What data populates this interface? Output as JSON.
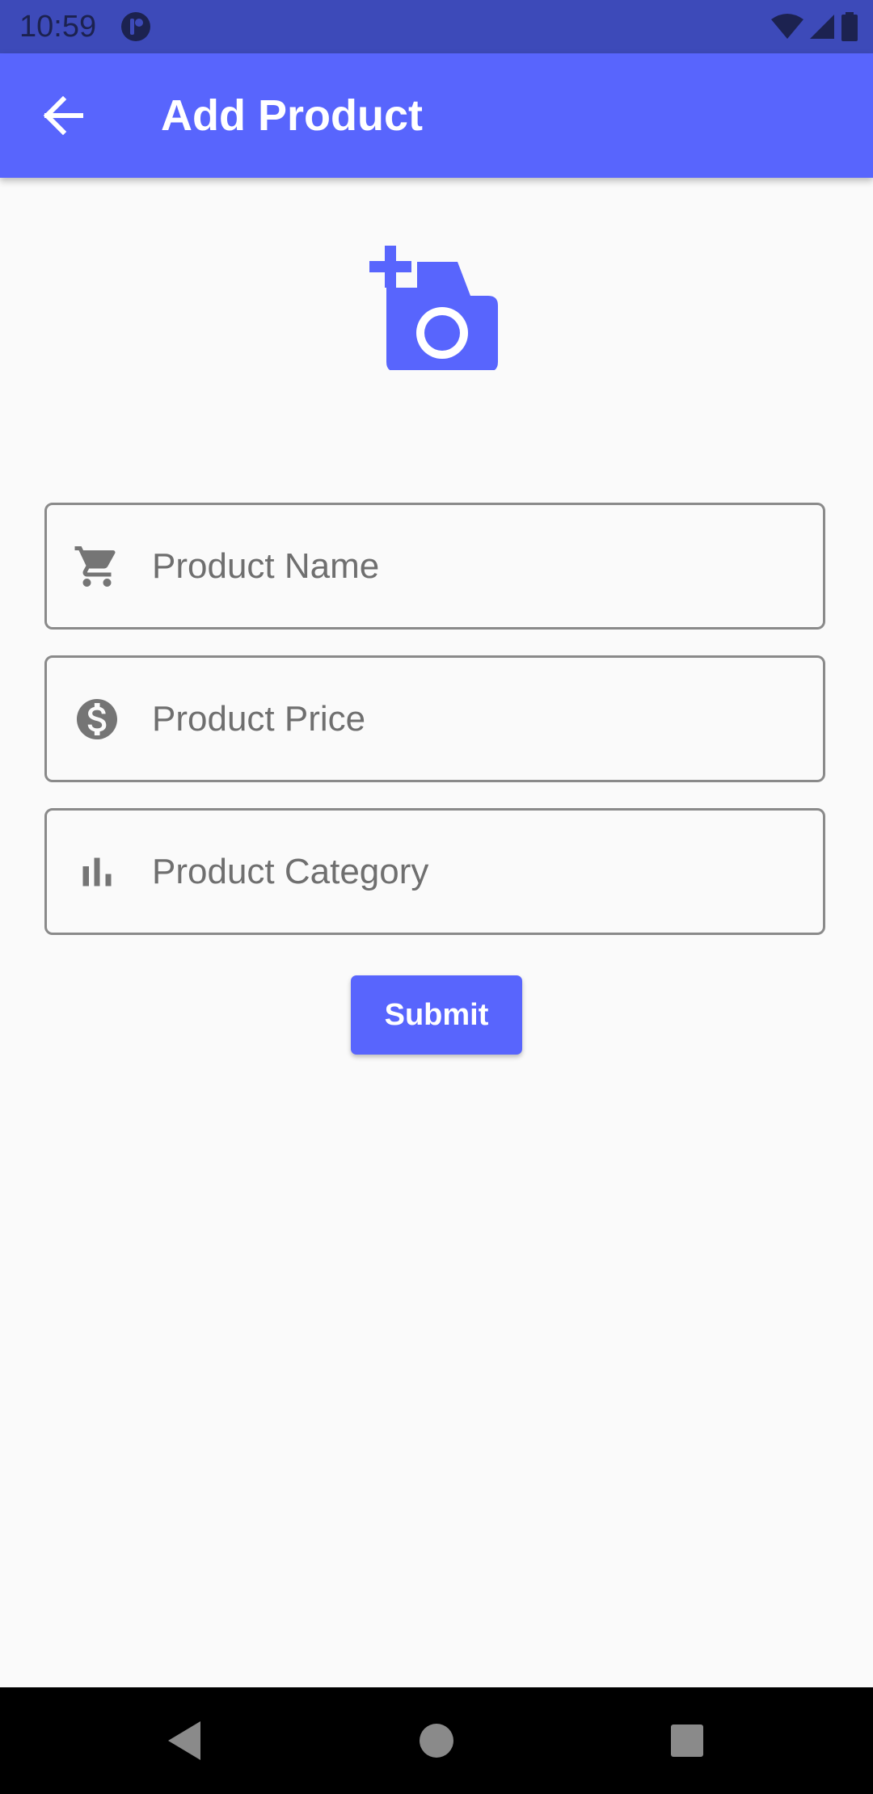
{
  "status_bar": {
    "time": "10:59",
    "icons": [
      "app-notification-icon",
      "wifi-icon",
      "signal-icon",
      "battery-icon"
    ]
  },
  "app_bar": {
    "back_icon": "arrow-left-icon",
    "title": "Add Product",
    "color": "#5865fd"
  },
  "photo": {
    "icon": "add-a-photo-icon"
  },
  "form": {
    "fields": [
      {
        "icon": "shopping-cart-icon",
        "placeholder": "Product Name",
        "value": ""
      },
      {
        "icon": "dollar-circle-icon",
        "placeholder": "Product Price",
        "value": ""
      },
      {
        "icon": "bar-chart-icon",
        "placeholder": "Product Category",
        "value": ""
      }
    ],
    "submit_label": "Submit"
  },
  "nav_bar": {
    "buttons": [
      "back-triangle-icon",
      "home-circle-icon",
      "recents-square-icon"
    ]
  }
}
